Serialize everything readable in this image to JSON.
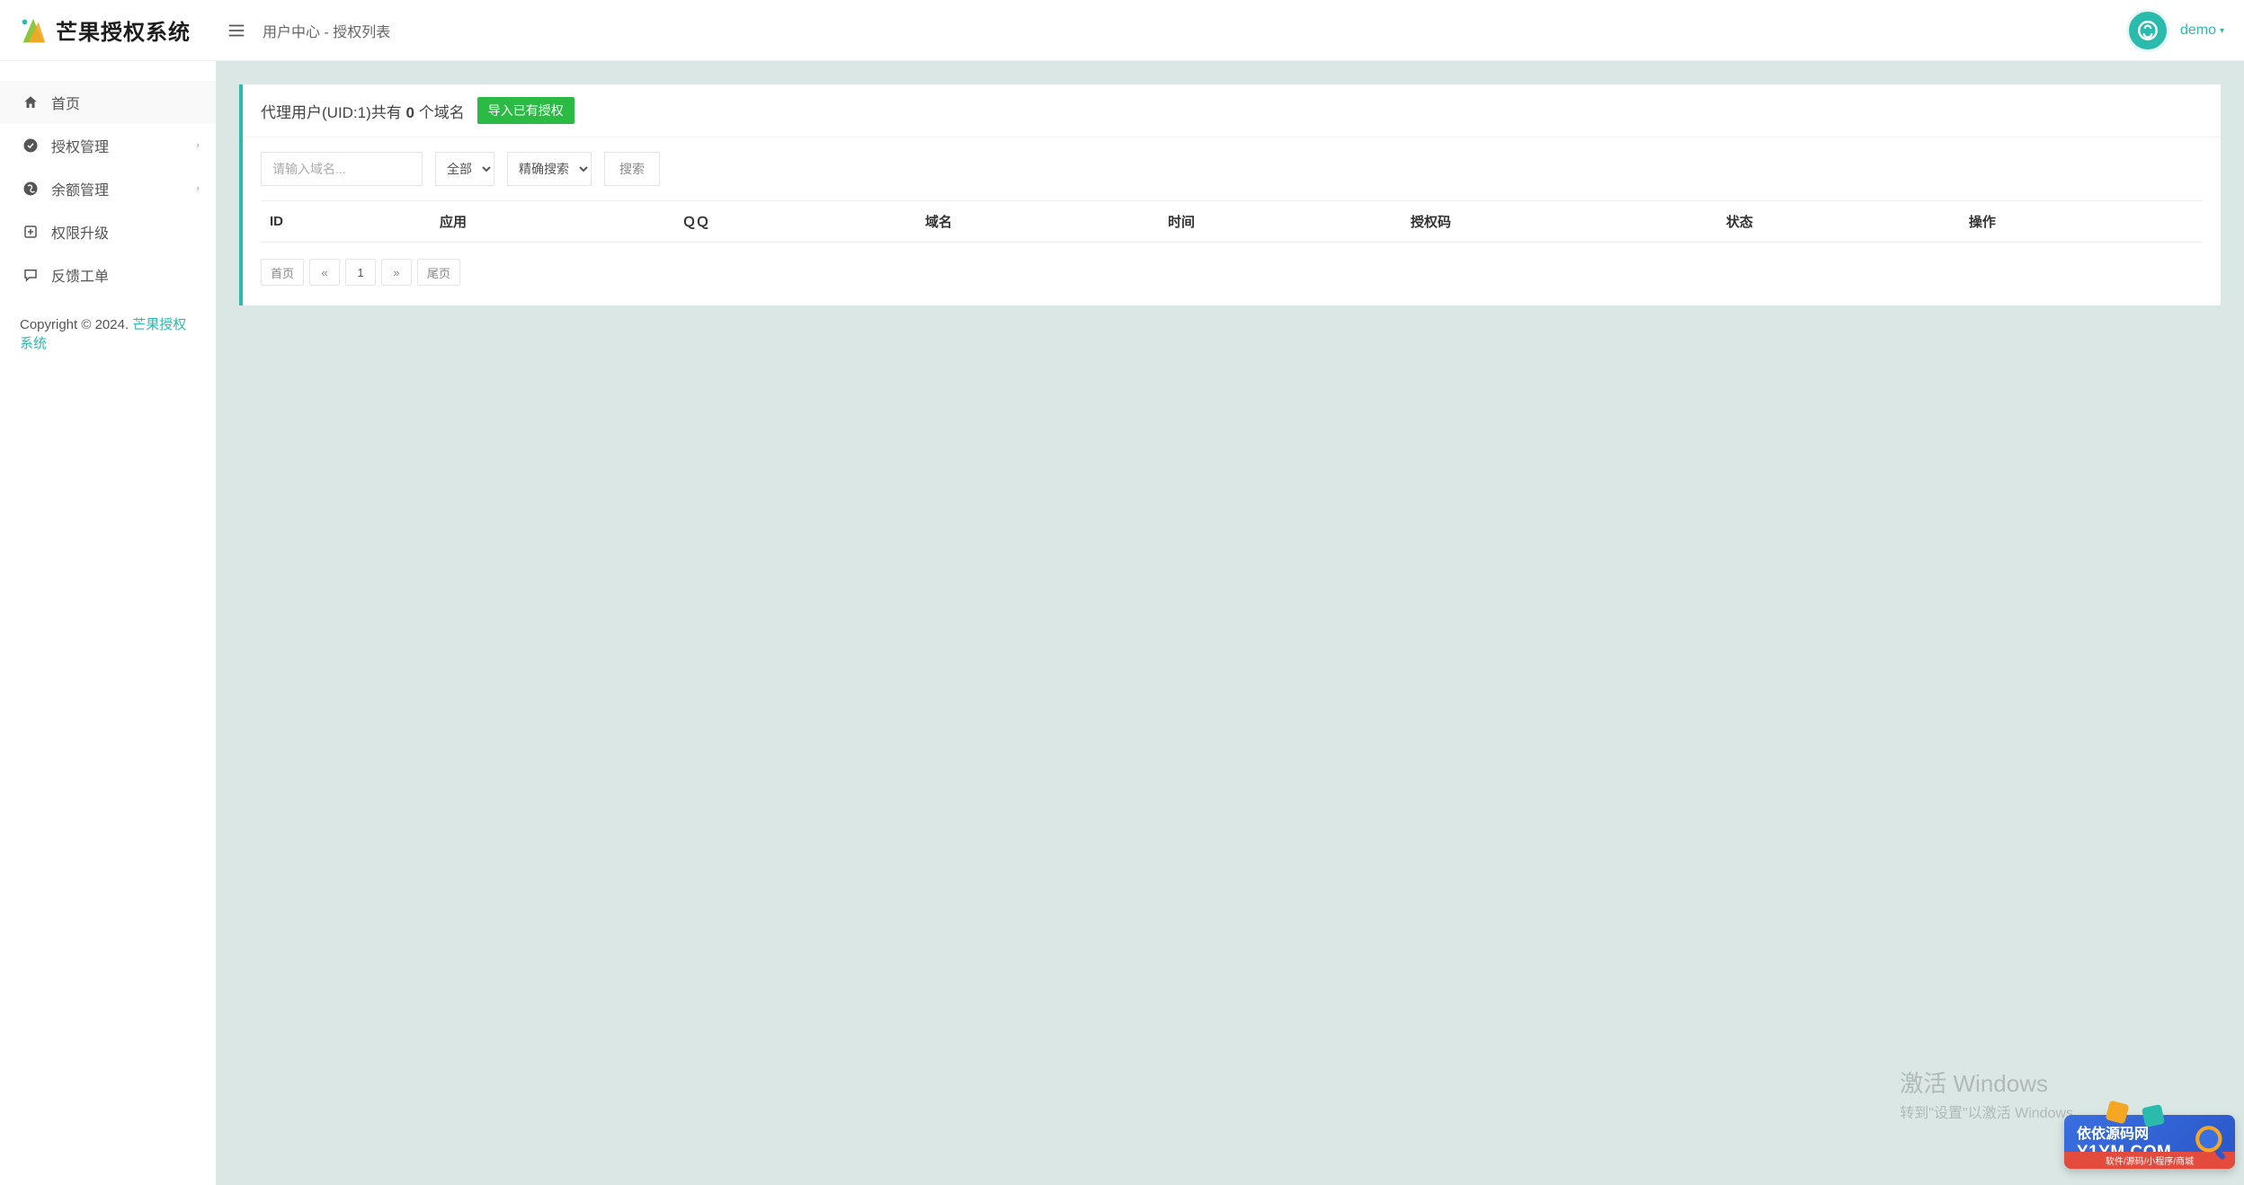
{
  "brand": "芒果授权系统",
  "breadcrumb": "用户中心 - 授权列表",
  "user": {
    "name": "demo"
  },
  "sidebar": {
    "items": [
      {
        "label": "首页",
        "icon": "home",
        "expandable": false
      },
      {
        "label": "授权管理",
        "icon": "check-circle",
        "expandable": true
      },
      {
        "label": "余额管理",
        "icon": "skype",
        "expandable": true
      },
      {
        "label": "权限升级",
        "icon": "plus-square",
        "expandable": false
      },
      {
        "label": "反馈工单",
        "icon": "chat",
        "expandable": false
      }
    ]
  },
  "copyright": {
    "prefix": "Copyright © 2024. ",
    "link": "芒果授权系统"
  },
  "panel": {
    "title_prefix": "代理用户(UID:1)共有 ",
    "count": "0",
    "title_suffix": " 个域名",
    "import_button": "导入已有授权"
  },
  "filters": {
    "domain_placeholder": "请输入域名...",
    "select_all": {
      "value": "全部",
      "options": [
        "全部"
      ]
    },
    "select_match": {
      "value": "精确搜索",
      "options": [
        "精确搜索"
      ]
    },
    "search_button": "搜索"
  },
  "table": {
    "headers": [
      "ID",
      "应用",
      "ＱＱ",
      "域名",
      "时间",
      "授权码",
      "状态",
      "操作"
    ],
    "rows": []
  },
  "pagination": {
    "first": "首页",
    "prev": "«",
    "page": "1",
    "next": "»",
    "last": "尾页"
  },
  "watermark": {
    "line1": "激活 Windows",
    "line2": "转到\"设置\"以激活 Windows"
  },
  "corner": {
    "line1": "依依源码网",
    "line2": "Y1YM.COM",
    "line3": "软件/源码/小程序/商城"
  }
}
